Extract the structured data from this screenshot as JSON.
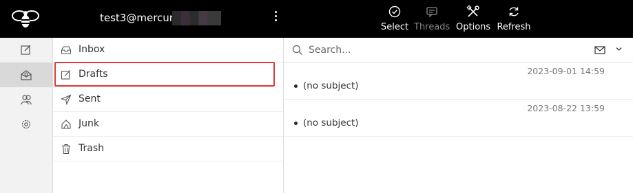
{
  "header": {
    "account": "test3@mercury.",
    "toolbar": [
      {
        "label": "Select",
        "icon": "select-check-icon",
        "disabled": false
      },
      {
        "label": "Threads",
        "icon": "threads-icon",
        "disabled": true
      },
      {
        "label": "Options",
        "icon": "options-tools-icon",
        "disabled": false
      },
      {
        "label": "Refresh",
        "icon": "refresh-icon",
        "disabled": false
      }
    ]
  },
  "rail": {
    "items": [
      {
        "icon": "compose-icon"
      },
      {
        "icon": "mail-icon",
        "active": true
      },
      {
        "icon": "contacts-icon"
      },
      {
        "icon": "settings-gear-icon"
      }
    ]
  },
  "folders": [
    {
      "label": "Inbox",
      "icon": "inbox-icon"
    },
    {
      "label": "Drafts",
      "icon": "drafts-icon",
      "selected": true
    },
    {
      "label": "Sent",
      "icon": "sent-icon"
    },
    {
      "label": "Junk",
      "icon": "junk-icon"
    },
    {
      "label": "Trash",
      "icon": "trash-icon"
    }
  ],
  "search": {
    "placeholder": "Search..."
  },
  "messages": [
    {
      "date": "2023-09-01 14:59",
      "subject": "(no subject)"
    },
    {
      "date": "2023-08-22 13:59",
      "subject": "(no subject)"
    }
  ],
  "colors": {
    "topbar": "#000000",
    "highlight": "#e03a3a",
    "rail": "#f2f2f2"
  }
}
